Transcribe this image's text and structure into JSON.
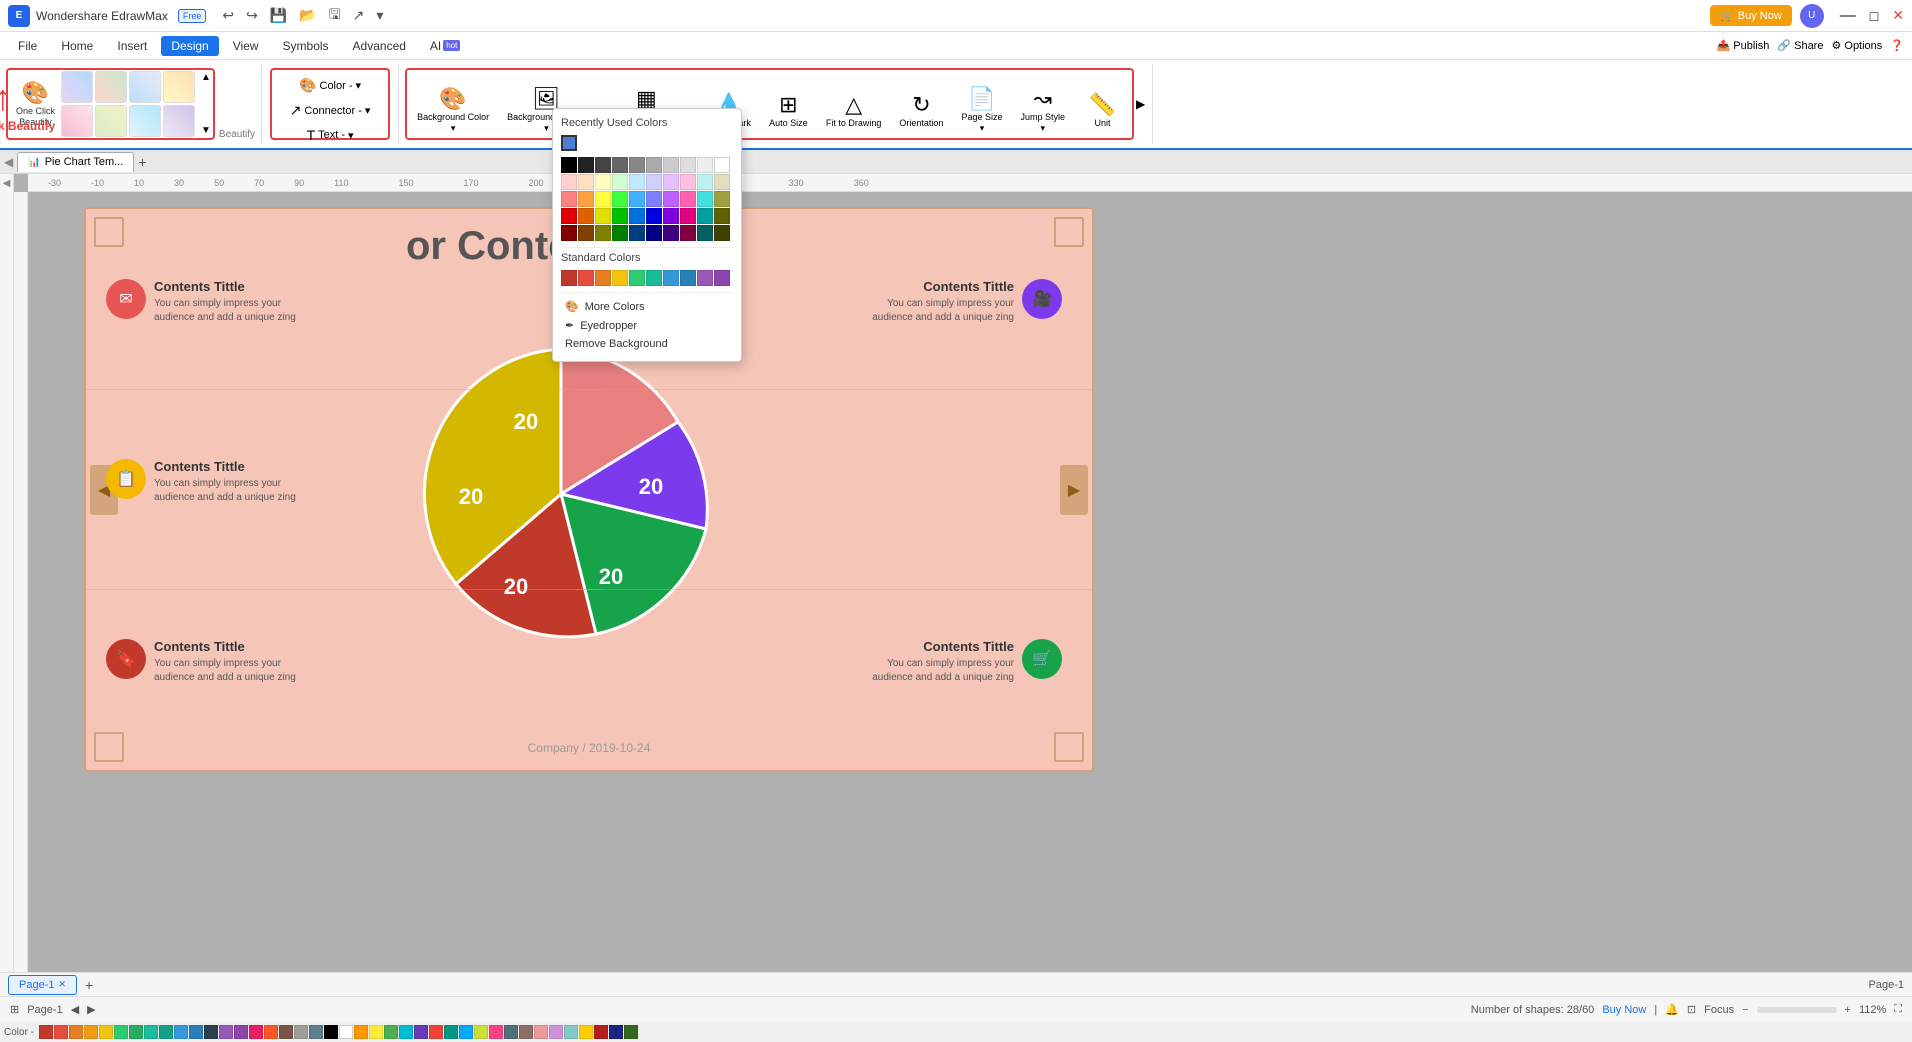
{
  "app": {
    "name": "Wondershare EdrawMax",
    "free_badge": "Free",
    "title": "",
    "buy_now": "Buy Now"
  },
  "menu": {
    "items": [
      "File",
      "Home",
      "Insert",
      "Design",
      "View",
      "Symbols",
      "Advanced",
      "AI"
    ]
  },
  "ribbon": {
    "beautify_group": {
      "label": "Beautify",
      "one_click_label": "One Click\nBeautify",
      "buttons": [
        "btn1",
        "btn2",
        "btn3",
        "btn4",
        "btn5",
        "btn6",
        "btn7",
        "btn8",
        "btn9"
      ]
    },
    "color_section": {
      "color_label": "Color -",
      "connector_label": "Connector -",
      "text_label": "Text -"
    },
    "design_tools": {
      "background_color": "Background\nColor",
      "background_picture": "Background\nPicture",
      "borders_headers": "Borders and\nHeaders",
      "watermark": "Watermark",
      "auto_size": "Auto\nSize",
      "fit_to_drawing": "Fit to\nDrawing",
      "orientation": "Orientation",
      "page_size": "Page\nSize",
      "jump_style": "Jump\nStyle",
      "unit": "Unit"
    }
  },
  "canvas": {
    "tab_name": "Pie Chart Tem...",
    "zoom": "112%",
    "shapes_count": "Number of shapes: 28/60"
  },
  "diagram": {
    "title": "r Content",
    "subtitle": "or Content",
    "full_title": "or Content",
    "company": "Company / 2019-10-24",
    "content_boxes": [
      {
        "id": "top-left",
        "title": "Contents Tittle",
        "desc": "You can simply impress your\naudience and add a unique zing",
        "icon_color": "#e85555",
        "icon": "✉"
      },
      {
        "id": "mid-left",
        "title": "Contents Tittle",
        "desc": "You can simply impress your\naudience and add a unique zing",
        "icon_color": "#f5b800",
        "icon": "📋"
      },
      {
        "id": "bot-left",
        "title": "Contents Tittle",
        "desc": "You can simply impress your\naudience and add a unique zing",
        "icon_color": "#c0392b",
        "icon": "🔖"
      },
      {
        "id": "top-right",
        "title": "Contents Tittle",
        "desc": "You can simply impress your\naudience and add a unique zing",
        "icon_color": "#7c3aed",
        "icon": "🎥"
      },
      {
        "id": "bot-right",
        "title": "Contents Tittle",
        "desc": "You can simply impress your\naudience and add a unique zing",
        "icon_color": "#16a34a",
        "icon": "🛒"
      }
    ],
    "pie_segments": [
      {
        "label": "20",
        "color": "#e88080"
      },
      {
        "label": "20",
        "color": "#7c3aed"
      },
      {
        "label": "20",
        "color": "#16a34a"
      },
      {
        "label": "20",
        "color": "#c0392b"
      },
      {
        "label": "20",
        "color": "#d4b800"
      }
    ]
  },
  "color_dropdown": {
    "recently_used_title": "Recently Used Colors",
    "standard_colors_title": "Standard Colors",
    "more_colors": "More Colors",
    "eyedropper": "Eyedropper",
    "remove_background": "Remove Background",
    "recently_used": [
      "#4a7fd4"
    ],
    "standard_colors": [
      "#c0392b",
      "#e74c3c",
      "#e67e22",
      "#f1c40f",
      "#2ecc71",
      "#1abc9c",
      "#3498db",
      "#2980b9",
      "#9b59b6",
      "#8e44ad"
    ],
    "gradient_rows": 6
  },
  "annotation": {
    "one_click_beautify": "One-click Beautify"
  },
  "pages": [
    "Page-1"
  ],
  "current_page": "Page-1",
  "status": {
    "shapes_info": "Number of shapes: 28/60",
    "buy_now": "Buy Now",
    "zoom": "112%",
    "focus": "Focus"
  },
  "color_bar_label": "Color -"
}
